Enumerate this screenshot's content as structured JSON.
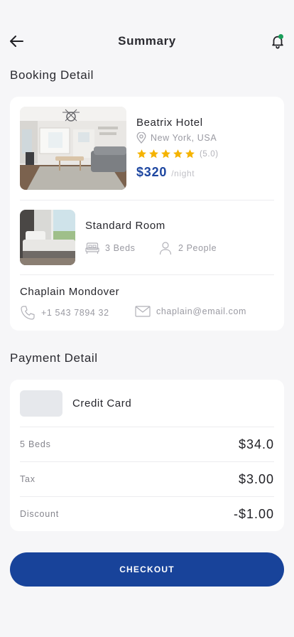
{
  "header": {
    "title": "Summary",
    "back_icon": "arrow-left-icon",
    "notification_icon": "bell-icon",
    "notification_dot_color": "#1a9e5a"
  },
  "booking": {
    "section_title": "Booking Detail",
    "hotel": {
      "name": "Beatrix Hotel",
      "location": "New York, USA",
      "rating_stars": 5,
      "rating_text": "(5.0)",
      "price": "$320",
      "price_unit": "/night",
      "star_color": "#f5b300",
      "price_color": "#1d46a0"
    },
    "room": {
      "name": "Standard Room",
      "beds": "3 Beds",
      "people": "2 People"
    },
    "guest": {
      "name": "Chaplain Mondover",
      "phone": "+1 543 7894 32",
      "email": "chaplain@email.com"
    }
  },
  "payment": {
    "section_title": "Payment Detail",
    "method": "Credit Card",
    "rows": [
      {
        "label": "5 Beds",
        "value": "$34.0"
      },
      {
        "label": "Tax",
        "value": "$3.00"
      },
      {
        "label": "Discount",
        "value": "-$1.00"
      }
    ]
  },
  "checkout": {
    "label": "CHECKOUT",
    "color": "#18439a"
  }
}
